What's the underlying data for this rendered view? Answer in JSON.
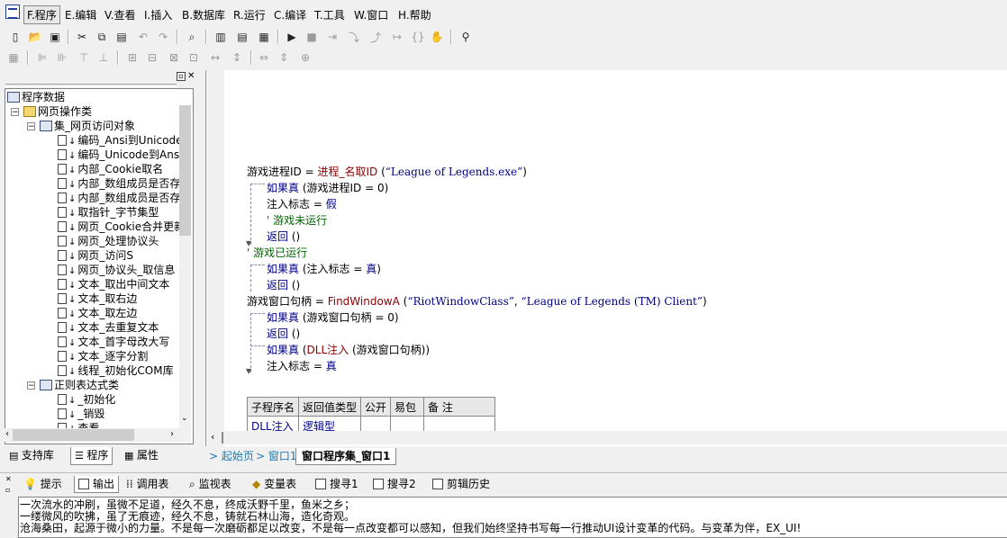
{
  "menu": [
    "F.程序",
    "E.编辑",
    "V.查看",
    "I.插入",
    "B.数据库",
    "R.运行",
    "C.编译",
    "T.工具",
    "W.窗口",
    "H.帮助"
  ],
  "tree": {
    "root": "程序数据",
    "items": [
      {
        "label": "网页操作类",
        "level": 1,
        "icon": "folder-icon"
      },
      {
        "label": "集_网页访问对象",
        "level": 2,
        "icon": "class-icon"
      },
      {
        "label": "编码_Ansi到Unicode",
        "level": 3,
        "icon": "method-icon"
      },
      {
        "label": "编码_Unicode到Ansi",
        "level": 3,
        "icon": "method-icon"
      },
      {
        "label": "内部_Cookie取名",
        "level": 3,
        "icon": "method-icon"
      },
      {
        "label": "内部_数组成员是否存",
        "level": 3,
        "icon": "method-icon"
      },
      {
        "label": "内部_数组成员是否存",
        "level": 3,
        "icon": "method-icon"
      },
      {
        "label": "取指针_字节集型",
        "level": 3,
        "icon": "method-icon"
      },
      {
        "label": "网页_Cookie合并更新",
        "level": 3,
        "icon": "method-icon"
      },
      {
        "label": "网页_处理协议头",
        "level": 3,
        "icon": "method-icon"
      },
      {
        "label": "网页_访问S",
        "level": 3,
        "icon": "method-icon"
      },
      {
        "label": "网页_协议头_取信息",
        "level": 3,
        "icon": "method-icon"
      },
      {
        "label": "文本_取出中间文本",
        "level": 3,
        "icon": "method-icon"
      },
      {
        "label": "文本_取右边",
        "level": 3,
        "icon": "method-icon"
      },
      {
        "label": "文本_取左边",
        "level": 3,
        "icon": "method-icon"
      },
      {
        "label": "文本_去重复文本",
        "level": 3,
        "icon": "method-icon"
      },
      {
        "label": "文本_首字母改大写",
        "level": 3,
        "icon": "method-icon"
      },
      {
        "label": "文本_逐字分割",
        "level": 3,
        "icon": "method-icon"
      },
      {
        "label": "线程_初始化COM库",
        "level": 3,
        "icon": "method-icon"
      },
      {
        "label": "正则表达式类",
        "level": 2,
        "icon": "class-icon"
      },
      {
        "label": "_初始化",
        "level": 3,
        "icon": "method-icon"
      },
      {
        "label": "_销毁",
        "level": 3,
        "icon": "method-icon"
      },
      {
        "label": "查看",
        "level": 3,
        "icon": "method-icon"
      }
    ]
  },
  "left_tabs": [
    "支持库",
    "程序",
    "属性"
  ],
  "code": {
    "l1_var": "游戏进程ID",
    "l1_op": " = ",
    "l1_fn": "进程_名取ID",
    "l1_open": " (",
    "l1_str": "“League of Legends.exe”",
    "l1_close": ")",
    "l2_kw": "如果真",
    "l2_rest": " (游戏进程ID = 0)",
    "l3": "注入标志 = ",
    "l3_val": "假",
    "l4": "' 游戏未运行",
    "l5_kw": "返回",
    "l5_rest": " ()",
    "l6": "' 游戏已运行",
    "l7_kw": "如果真",
    "l7_rest": " (注入标志 = ",
    "l7_val": "真",
    "l7_end": ")",
    "l8_kw": "返回",
    "l8_rest": " ()",
    "l9_var": "游戏窗口句柄",
    "l9_op": " = ",
    "l9_fn": "FindWindowA",
    "l9_open": " (",
    "l9_str1": "“RiotWindowClass”",
    "l9_comma": ", ",
    "l9_str2": "“League of Legends (TM) Client”",
    "l9_close": ")",
    "l10_kw": "如果真",
    "l10_rest": " (游戏窗口句柄 = 0)",
    "l11_kw": "返回",
    "l11_rest": " ()",
    "l12_kw": "如果真",
    "l12_open": " (",
    "l12_fn": "DLL注入",
    "l12_rest": " (游戏窗口句柄))",
    "l13": "注入标志 = ",
    "l13_val": "真"
  },
  "sub_table": {
    "headers": [
      "子程序名",
      "返回值类型",
      "公开",
      "易包",
      "备 注"
    ],
    "row": [
      "DLL注入",
      "逻辑型",
      "",
      "",
      ""
    ]
  },
  "editor_tabs": [
    "起始页",
    "窗口1",
    "窗口程序集_窗口1"
  ],
  "bottom_tabs": [
    "提示",
    "输出",
    "调用表",
    "监视表",
    "变量表",
    "搜寻1",
    "搜寻2",
    "剪辑历史"
  ],
  "output": [
    "一次流水的冲刷，虽微不足道，经久不息，终成沃野千里，鱼米之乡；",
    "一缕微风的吹拂，虽了无痕迹，经久不息，铸就石林山海，造化奇观。",
    "沧海桑田，起源于微小的力量。不是每一次磨砺都足以改变，不是每一点改变都可以感知，但我们始终坚持书写每一行推动UI设计变革的代码。与变革为伴，EX_UI!"
  ]
}
